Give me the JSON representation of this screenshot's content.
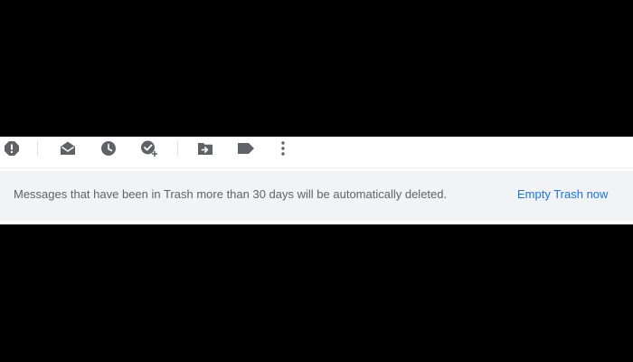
{
  "toolbar": {
    "icons": [
      {
        "name": "report-spam-icon"
      },
      {
        "name": "mark-as-read-icon"
      },
      {
        "name": "snooze-icon"
      },
      {
        "name": "add-to-tasks-icon"
      },
      {
        "name": "move-to-icon"
      },
      {
        "name": "labels-icon"
      },
      {
        "name": "more-options-icon"
      }
    ]
  },
  "trash_banner": {
    "message": "Messages that have been in Trash more than 30 days will be automatically deleted.",
    "action_label": "Empty Trash now"
  },
  "colors": {
    "icon": "#5f6368",
    "banner_bg": "#f1f3f4",
    "banner_text": "#5f6368",
    "link": "#1a73e8",
    "letterbox": "#000000"
  }
}
